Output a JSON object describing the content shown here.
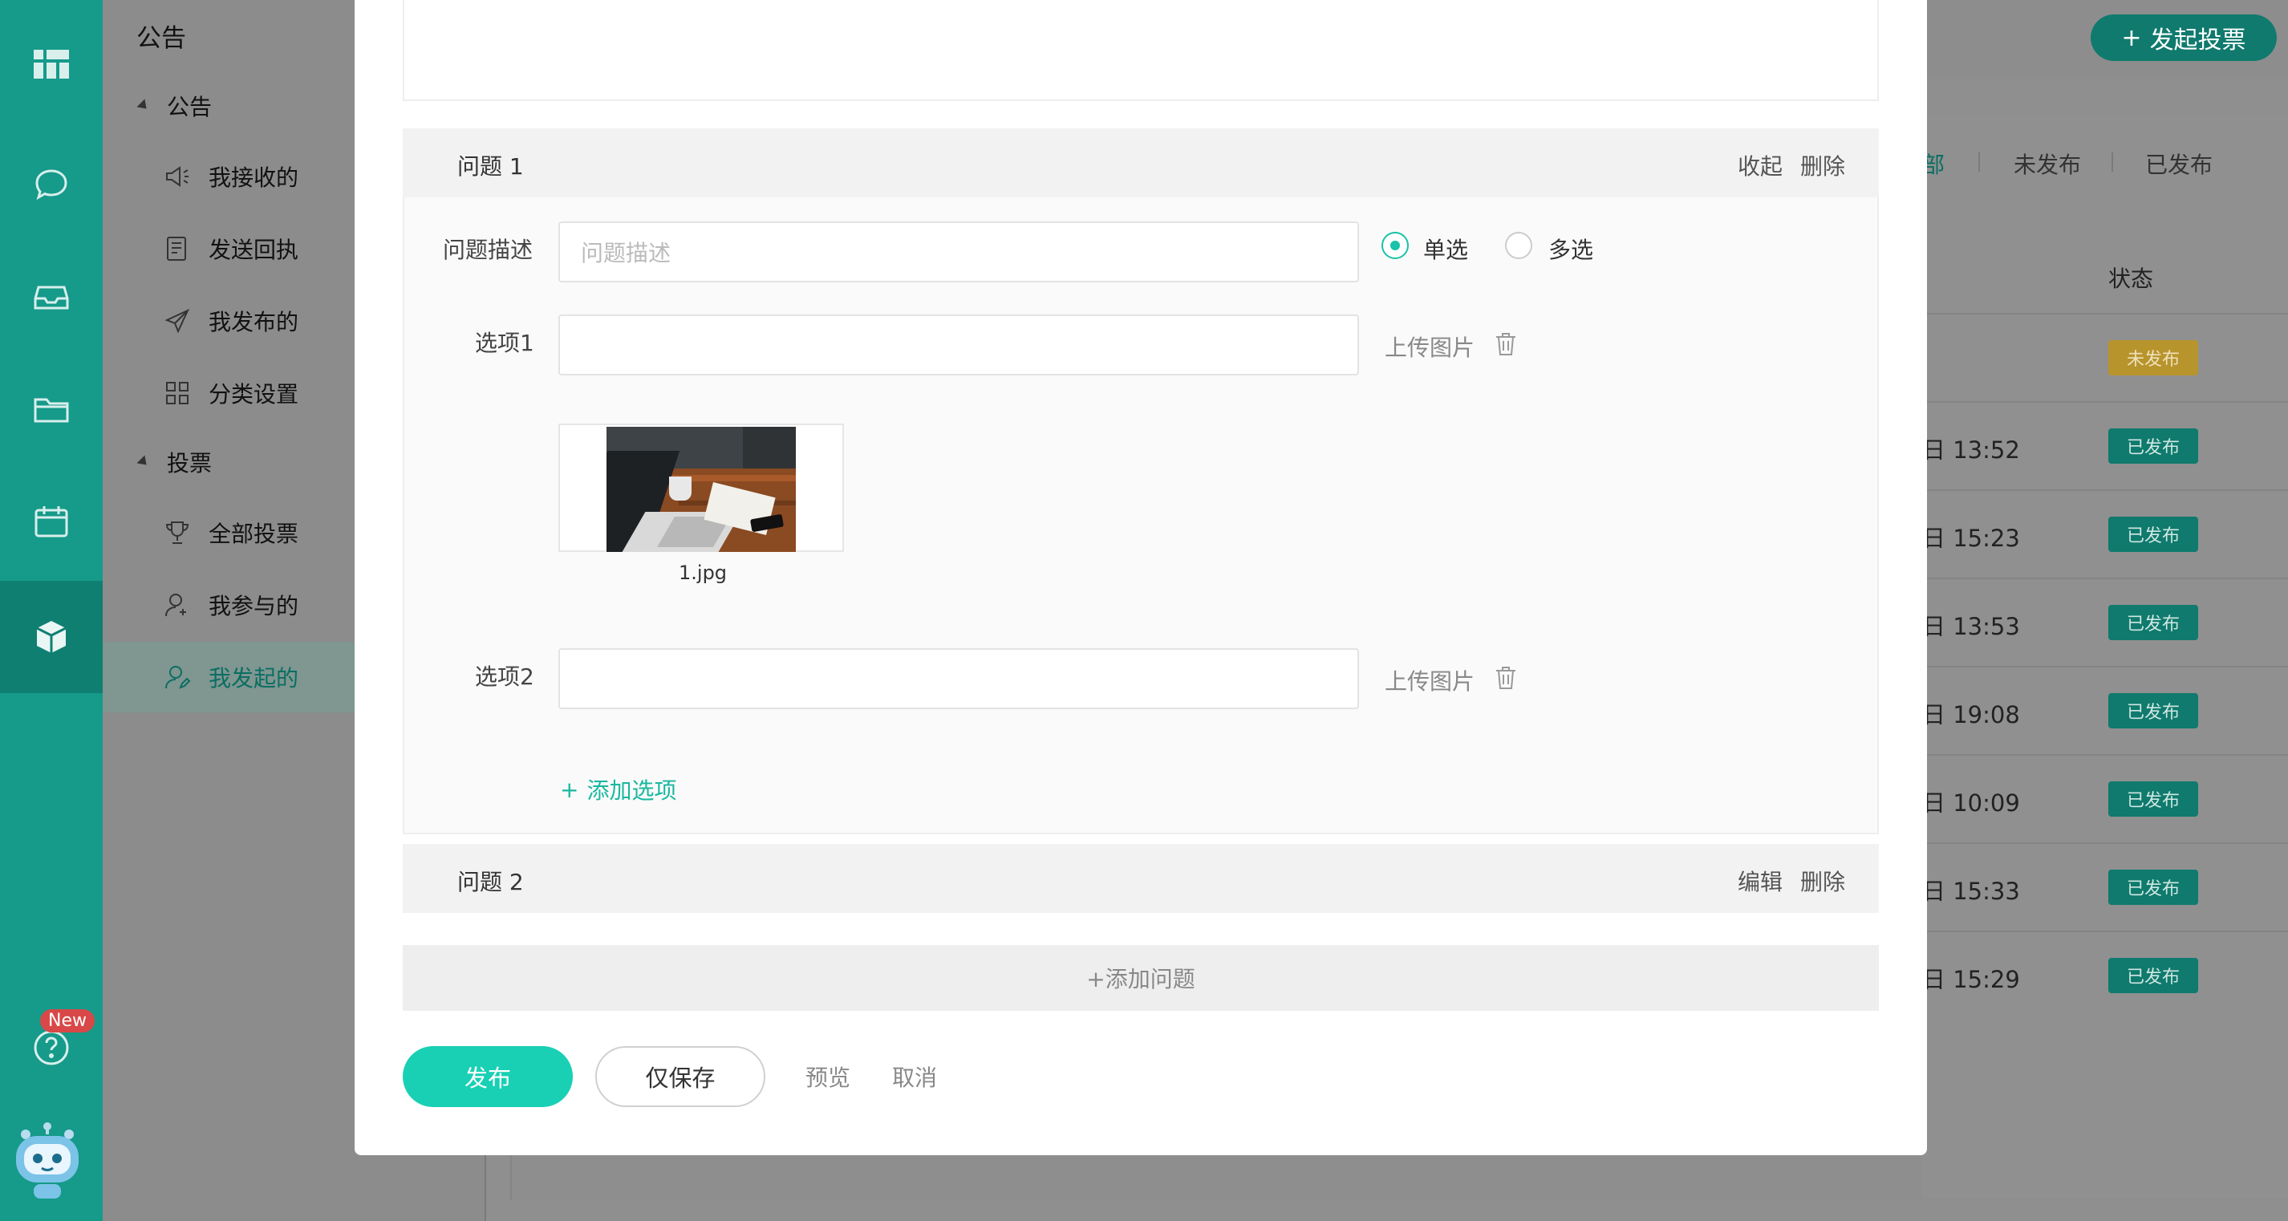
{
  "colors": {
    "rail": "#169a8a",
    "accent": "#19d0b4",
    "published_badge": "#0f7a6d",
    "draft_badge": "#b8942d"
  },
  "rail": {
    "items": [
      "dashboard-icon",
      "chat-icon",
      "inbox-icon",
      "folder-icon",
      "calendar-icon",
      "cube-icon"
    ],
    "help_badge": "New"
  },
  "subnav": {
    "title": "公告",
    "groups": [
      {
        "label": "公告",
        "items": [
          "我接收的",
          "发送回执",
          "我发布的",
          "分类设置"
        ]
      },
      {
        "label": "投票",
        "items": [
          "全部投票",
          "我参与的",
          "我发起的"
        ]
      }
    ]
  },
  "background": {
    "start_vote": "发起投票",
    "tabs": [
      "部",
      "未发布",
      "已发布"
    ],
    "status_header": "状态",
    "rows": [
      {
        "date": "",
        "status": "未发布"
      },
      {
        "date": "日 13:52",
        "status": "已发布"
      },
      {
        "date": "日 15:23",
        "status": "已发布"
      },
      {
        "date": "日 13:53",
        "status": "已发布"
      },
      {
        "date": "日 19:08",
        "status": "已发布"
      },
      {
        "date": "日 10:09",
        "status": "已发布"
      },
      {
        "date": "日 15:33",
        "status": "已发布"
      },
      {
        "date": "日 15:29",
        "status": "已发布"
      }
    ]
  },
  "modal": {
    "question1": {
      "title": "问题 1",
      "collapse": "收起",
      "delete": "删除",
      "desc_label": "问题描述",
      "desc_placeholder": "问题描述",
      "single": "单选",
      "multi": "多选",
      "option1_label": "选项1",
      "option2_label": "选项2",
      "upload": "上传图片",
      "image_name": "1.jpg",
      "add_option": "添加选项"
    },
    "question2": {
      "title": "问题 2",
      "edit": "编辑",
      "delete": "删除"
    },
    "add_question": "+添加问题",
    "publish": "发布",
    "save_only": "仅保存",
    "preview": "预览",
    "cancel": "取消"
  }
}
